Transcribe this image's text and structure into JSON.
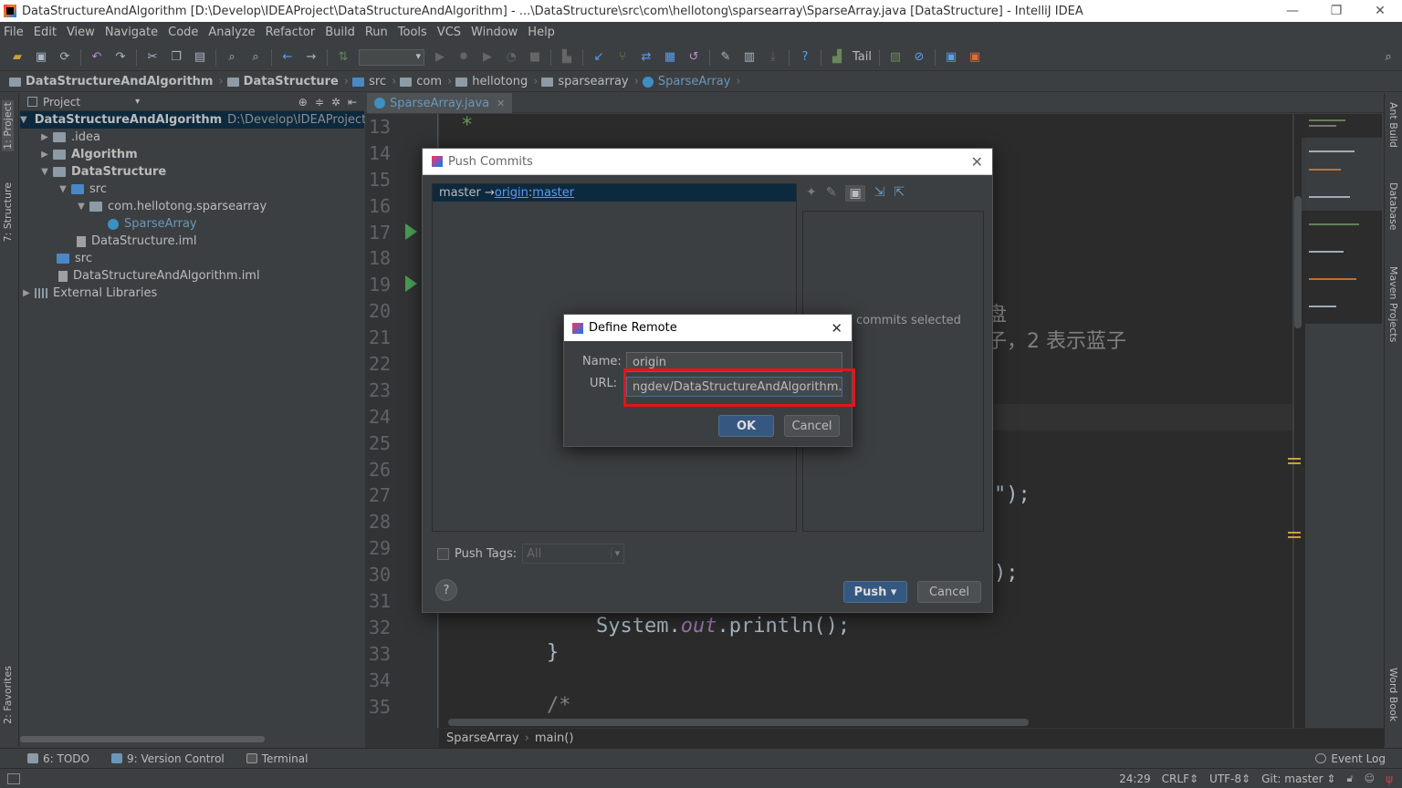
{
  "window": {
    "title": "DataStructureAndAlgorithm [D:\\Develop\\IDEAProject\\DataStructureAndAlgorithm] - ...\\DataStructure\\src\\com\\hellotong\\sparsearray\\SparseArray.java [DataStructure] - IntelliJ IDEA",
    "minimize": "—",
    "restore": "❐",
    "close": "✕"
  },
  "menu": [
    "File",
    "Edit",
    "View",
    "Navigate",
    "Code",
    "Analyze",
    "Refactor",
    "Build",
    "Run",
    "Tools",
    "VCS",
    "Window",
    "Help"
  ],
  "toolbar": {
    "tail_label": "Tail"
  },
  "navbar": {
    "crumbs": [
      "DataStructureAndAlgorithm",
      "DataStructure",
      "src",
      "com",
      "hellotong",
      "sparsearray",
      "SparseArray"
    ]
  },
  "left_stripe": {
    "project_tab": "1: Project",
    "structure_tab": "7: Structure",
    "favorites_tab": "2: Favorites"
  },
  "right_stripe": {
    "ant_tab": "Ant Build",
    "database_tab": "Database",
    "maven_tab": "Maven Projects",
    "word_tab": "Word Book"
  },
  "project_panel": {
    "header": "Project",
    "tree": [
      {
        "label": "DataStructureAndAlgorithm",
        "path": "D:\\Develop\\IDEAProject\\Da"
      },
      {
        "label": ".idea"
      },
      {
        "label": "Algorithm"
      },
      {
        "label": "DataStructure"
      },
      {
        "label": "src"
      },
      {
        "label": "com.hellotong.sparsearray"
      },
      {
        "label": "SparseArray"
      },
      {
        "label": "DataStructure.iml"
      },
      {
        "label": "src"
      },
      {
        "label": "DataStructureAndAlgorithm.iml"
      },
      {
        "label": "External Libraries"
      }
    ]
  },
  "editor": {
    "tab_label": "SparseArray.java",
    "line_numbers": [
      "13",
      "14",
      "15",
      "16",
      "17",
      "18",
      "19",
      "20",
      "21",
      "22",
      "23",
      "24",
      "25",
      "26",
      "27",
      "28",
      "29",
      "30",
      "31",
      "32",
      "33",
      "34",
      "35"
    ],
    "visible_code": {
      "l13": "*",
      "l20_cjk": "盘",
      "l21_cjk": "子，2 表示蓝子",
      "l27": "\");",
      "l30": ");",
      "l32_a": "System.",
      "l32_b": "out",
      "l32_c": ".println();",
      "l33": "}",
      "l35": "/*"
    },
    "breadcrumb": [
      "SparseArray",
      "main()"
    ]
  },
  "push_dialog": {
    "title": "Push Commits",
    "branch_prefix": "master → ",
    "remote": "origin",
    "colon": " : ",
    "target_branch": "master",
    "no_commits": "commits selected",
    "push_tags_label": "Push Tags:",
    "tags_value": "All",
    "help": "?",
    "push_button": "Push ▾",
    "cancel_button": "Cancel"
  },
  "define_remote": {
    "title": "Define Remote",
    "name_label": "Name:",
    "name_value": "origin",
    "url_label": "URL:",
    "url_value": "ngdev/DataStructureAndAlgorithm.git",
    "ok_button": "OK",
    "cancel_button": "Cancel"
  },
  "bottom_tools": {
    "todo": "6: TODO",
    "vcs": "9: Version Control",
    "terminal": "Terminal",
    "event_log": "Event Log"
  },
  "status": {
    "position": "24:29",
    "line_sep": "CRLF⇕",
    "encoding": "UTF-8⇕",
    "git": "Git: master ⇕"
  }
}
